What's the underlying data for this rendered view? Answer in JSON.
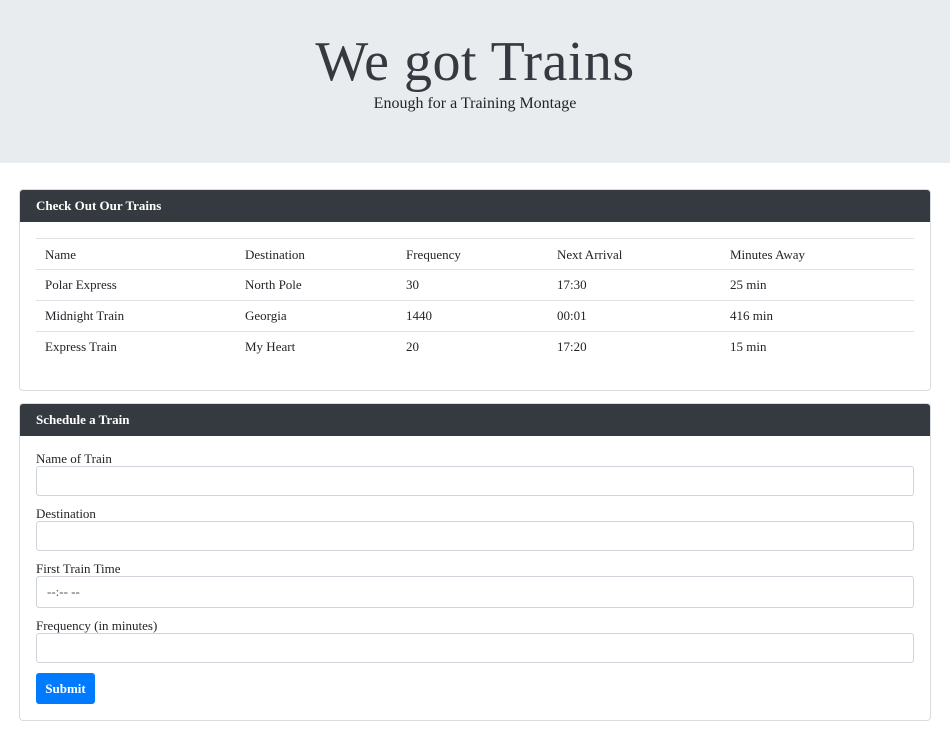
{
  "header": {
    "title": "We got Trains",
    "subtitle": "Enough for a Training Montage"
  },
  "trains_card": {
    "title": "Check Out Our Trains",
    "columns": [
      "Name",
      "Destination",
      "Frequency",
      "Next Arrival",
      "Minutes Away"
    ],
    "rows": [
      [
        "Polar Express",
        "North Pole",
        "30",
        "17:30",
        "25 min"
      ],
      [
        "Midnight Train",
        "Georgia",
        "1440",
        "00:01",
        "416 min"
      ],
      [
        "Express Train",
        "My Heart",
        "20",
        "17:20",
        "15 min"
      ]
    ]
  },
  "schedule_card": {
    "title": "Schedule a Train",
    "fields": [
      {
        "label": "Name of Train",
        "value": "",
        "placeholder": ""
      },
      {
        "label": "Destination",
        "value": "",
        "placeholder": ""
      },
      {
        "label": "First Train Time",
        "value": "",
        "placeholder": "--:-- --"
      },
      {
        "label": "Frequency (in minutes)",
        "value": "",
        "placeholder": ""
      }
    ],
    "submit_label": "Submit"
  },
  "colors": {
    "jumbotron_bg": "#e9ecef",
    "card_header_bg": "#343a40",
    "primary": "#007bff"
  }
}
